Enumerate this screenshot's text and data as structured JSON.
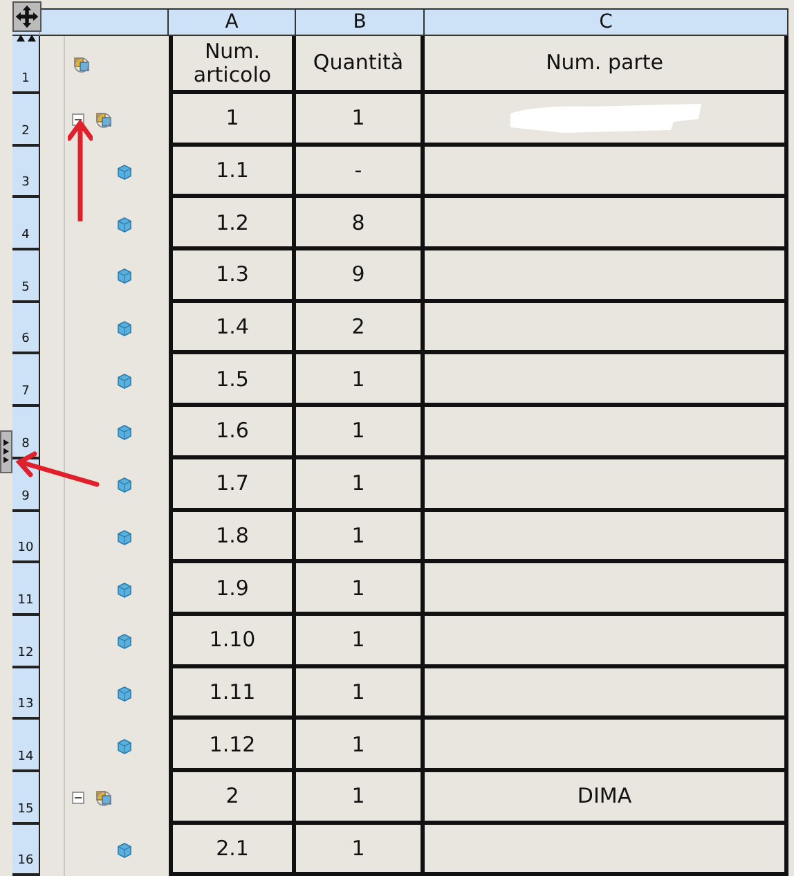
{
  "column_letters": [
    "A",
    "B",
    "C"
  ],
  "header": {
    "row_number": "1",
    "cells": [
      "Num. articolo",
      "Quantità",
      "Num. parte"
    ]
  },
  "rows": [
    {
      "row_number": "2",
      "kind": "assembly",
      "expanded": true,
      "item": "1",
      "quantity": "1",
      "part_redacted": true,
      "children": [
        {
          "row_number": "3",
          "kind": "part",
          "item": "1.1",
          "quantity": "-"
        },
        {
          "row_number": "4",
          "kind": "part",
          "item": "1.2",
          "quantity": "8"
        },
        {
          "row_number": "5",
          "kind": "part",
          "item": "1.3",
          "quantity": "9"
        },
        {
          "row_number": "6",
          "kind": "part",
          "item": "1.4",
          "quantity": "2"
        },
        {
          "row_number": "7",
          "kind": "part",
          "item": "1.5",
          "quantity": "1"
        },
        {
          "row_number": "8",
          "kind": "part",
          "item": "1.6",
          "quantity": "1"
        },
        {
          "row_number": "9",
          "kind": "part",
          "item": "1.7",
          "quantity": "1"
        },
        {
          "row_number": "10",
          "kind": "part",
          "item": "1.8",
          "quantity": "1"
        },
        {
          "row_number": "11",
          "kind": "part",
          "item": "1.9",
          "quantity": "1"
        },
        {
          "row_number": "12",
          "kind": "part",
          "item": "1.10",
          "quantity": "1"
        },
        {
          "row_number": "13",
          "kind": "part",
          "item": "1.11",
          "quantity": "1"
        },
        {
          "row_number": "14",
          "kind": "part",
          "item": "1.12",
          "quantity": "1"
        }
      ]
    },
    {
      "row_number": "15",
      "kind": "assembly",
      "expanded": true,
      "item": "2",
      "quantity": "1",
      "part": "DIMA",
      "children": [
        {
          "row_number": "16",
          "kind": "part",
          "item": "2.1",
          "quantity": "1"
        }
      ]
    }
  ]
}
